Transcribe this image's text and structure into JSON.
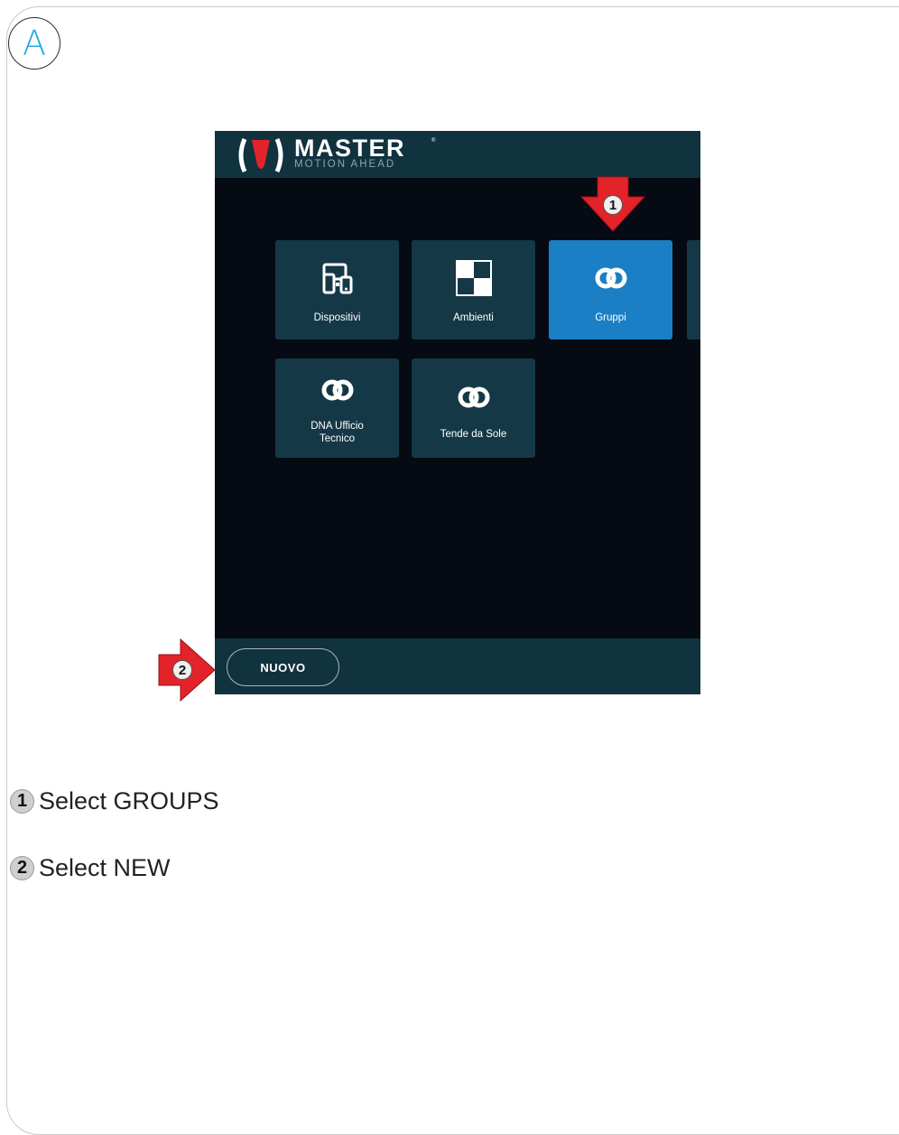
{
  "step_letter": "A",
  "app": {
    "brand": {
      "name": "MASTER",
      "tagline": "MOTION AHEAD",
      "reg_mark": "®"
    },
    "tiles": [
      {
        "label": "Dispositivi",
        "icon": "devices-icon",
        "active": false
      },
      {
        "label": "Ambienti",
        "icon": "rooms-grid-icon",
        "active": false
      },
      {
        "label": "Gruppi",
        "icon": "rings-icon",
        "active": true
      },
      {
        "label": "DNA Ufficio\nTecnico",
        "icon": "rings-icon",
        "active": false
      },
      {
        "label": "Tende da Sole",
        "icon": "rings-icon",
        "active": false
      }
    ],
    "footer": {
      "new_button": "NUOVO"
    }
  },
  "callouts": {
    "one": "1",
    "two": "2"
  },
  "instructions": [
    {
      "num": "1",
      "text": "Select GROUPS"
    },
    {
      "num": "2",
      "text": "Select NEW"
    }
  ],
  "colors": {
    "accent": "#29a9e1",
    "header_bg": "#11323f",
    "tile_bg": "#153847",
    "tile_active": "#1a7fc4",
    "arrow_red": "#e2232a"
  }
}
